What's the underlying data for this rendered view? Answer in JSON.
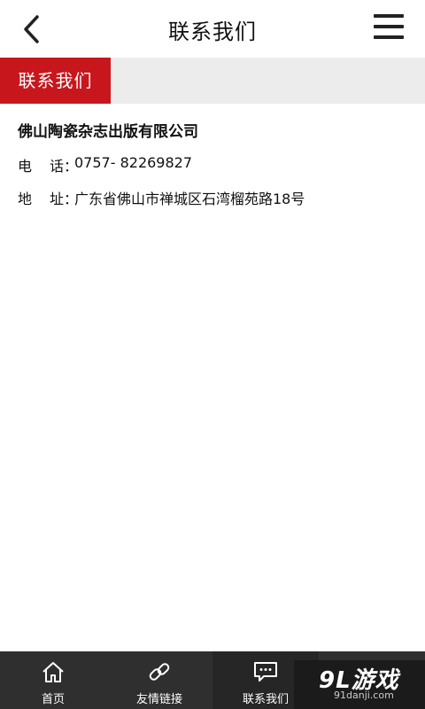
{
  "header": {
    "title": "联系我们",
    "back_icon": "chevron-left-icon",
    "menu_icon": "hamburger-menu-icon"
  },
  "section": {
    "label": "联系我们",
    "accent": "#c8161d"
  },
  "contact": {
    "company": "佛山陶瓷杂志出版有限公司",
    "phone_label_1": "电",
    "phone_label_2": "话",
    "phone": "0757- 82269827",
    "address_label_1": "地",
    "address_label_2": "址",
    "address": "广东省佛山市禅城区石湾榴苑路18号",
    "separator": "："
  },
  "tabbar": {
    "items": [
      {
        "label": "首页",
        "icon": "home-icon"
      },
      {
        "label": "友情链接",
        "icon": "link-icon"
      },
      {
        "label": "联系我们",
        "icon": "chat-bubble-icon"
      }
    ]
  },
  "watermark": {
    "main": "9L游戏",
    "sub": "91danji.com"
  }
}
